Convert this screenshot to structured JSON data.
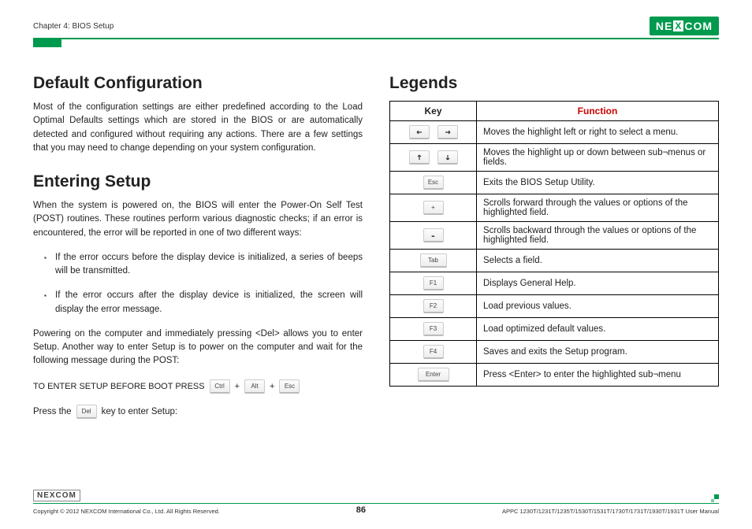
{
  "header": {
    "chapter": "Chapter 4: BIOS Setup",
    "logo_text": "NE",
    "logo_x": "X",
    "logo_text2": "COM"
  },
  "left": {
    "h1a": "Default Configuration",
    "p1": "Most of the configuration settings are either predefined according to the Load Optimal Defaults settings which are stored in the BIOS or are automatically detected and configured without requiring any actions. There are a few settings that you may need to change depending on your system configuration.",
    "h1b": "Entering Setup",
    "p2": "When the system is powered on, the BIOS will enter the Power-On Self Test (POST) routines. These routines perform various diagnostic checks; if an error is encountered, the error will be reported in one of two different ways:",
    "li1": "If the error occurs before the display device is initialized, a series of beeps will be transmitted.",
    "li2": "If the error occurs after the display device is initialized, the screen will display the error message.",
    "p3": "Powering on the computer and immediately pressing <Del> allows you to enter Setup. Another way to enter Setup is to power on the computer and wait for the following message during the POST:",
    "setup_label": "TO ENTER SETUP BEFORE BOOT PRESS",
    "k_ctrl": "Ctrl",
    "k_alt": "Alt",
    "k_esc": "Esc",
    "plus": "+",
    "press_a": "Press the",
    "k_del": "Del",
    "press_b": "key to enter Setup:"
  },
  "right": {
    "h1": "Legends",
    "th_key": "Key",
    "th_fn": "Function",
    "rows": [
      {
        "fn": "Moves the highlight left or right to select a menu."
      },
      {
        "fn": "Moves the highlight up or down between sub¬menus or fields."
      },
      {
        "key_text": "Esc",
        "fn": "Exits the BIOS Setup Utility."
      },
      {
        "key_text": "+",
        "fn": "Scrolls forward through the values or options of the highlighted field."
      },
      {
        "key_text": "-",
        "fn": "Scrolls backward through the values or options of the highlighted field."
      },
      {
        "key_text": "Tab",
        "fn": "Selects a field."
      },
      {
        "key_text": "F1",
        "fn": "Displays General Help."
      },
      {
        "key_text": "F2",
        "fn": "Load previous values."
      },
      {
        "key_text": "F3",
        "fn": "Load optimized default values."
      },
      {
        "key_text": "F4",
        "fn": "Saves and exits the Setup program."
      },
      {
        "key_text": "Enter",
        "fn": "Press <Enter> to enter the highlighted sub¬menu"
      }
    ]
  },
  "footer": {
    "logo": "NEXCOM",
    "copy": "Copyright © 2012 NEXCOM International Co., Ltd. All Rights Reserved.",
    "page": "86",
    "manual": "APPC 1230T/1231T/1235T/1530T/1531T/1730T/1731T/1930T/1931T User Manual"
  }
}
